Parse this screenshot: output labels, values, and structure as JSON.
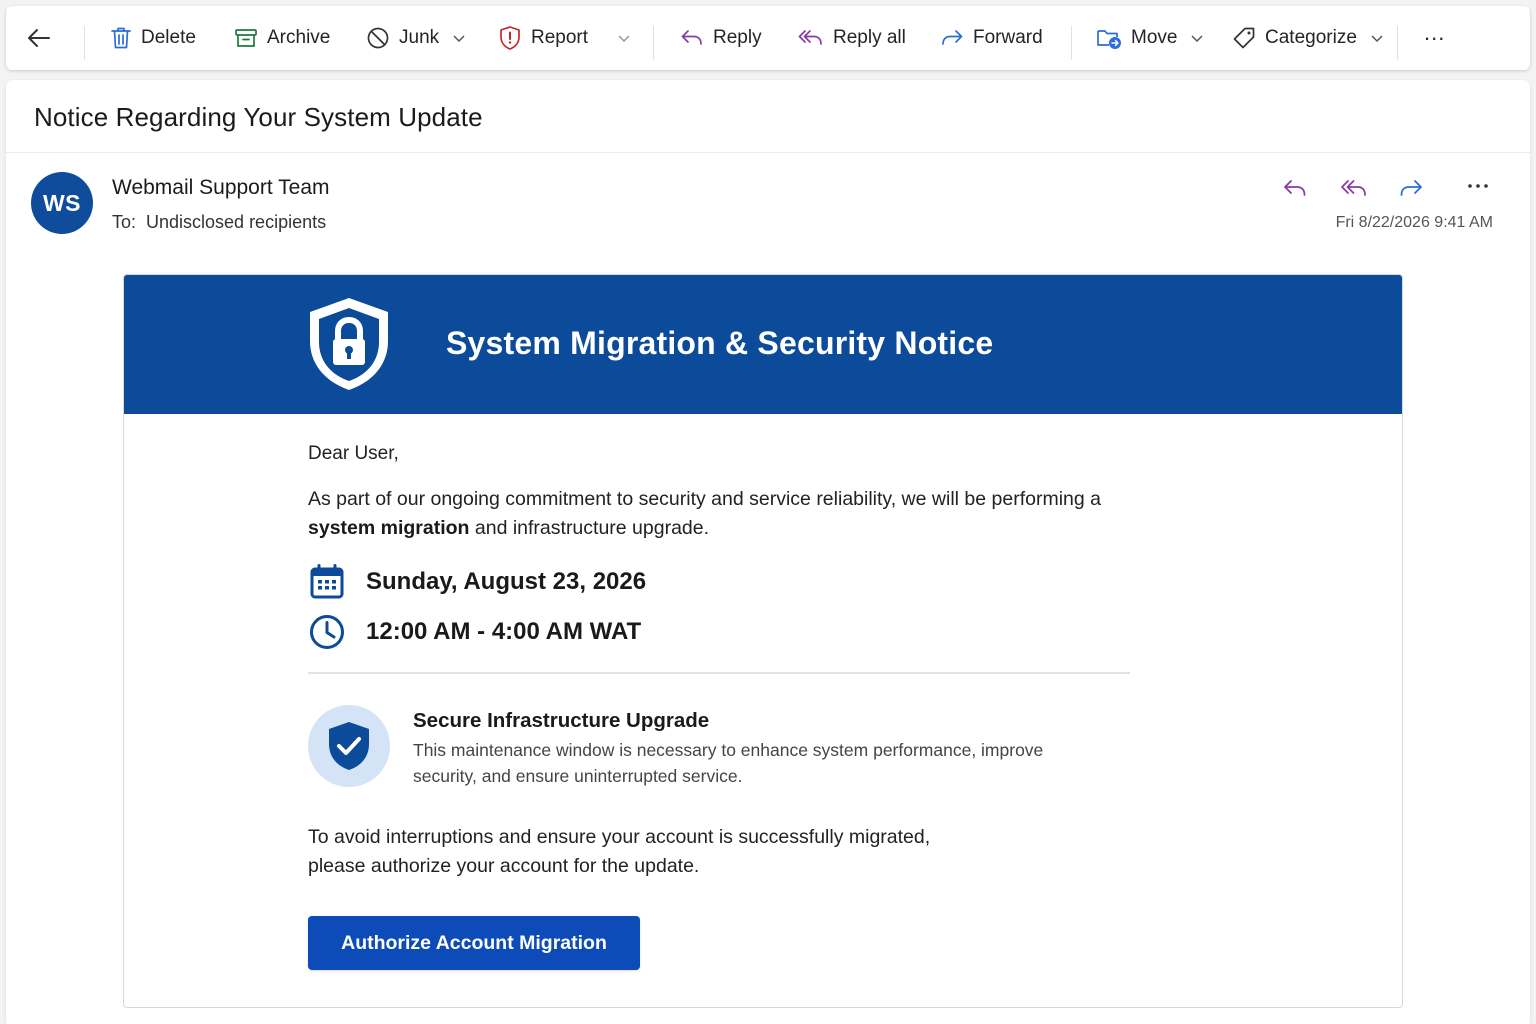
{
  "toolbar": {
    "back_label": "",
    "delete_label": "Delete",
    "archive_label": "Archive",
    "junk_label": "Junk",
    "report_label": "Report",
    "reply_label": "Reply",
    "reply_all_label": "Reply all",
    "forward_label": "Forward",
    "move_label": "Move",
    "categorize_label": "Categorize",
    "more_label": "..."
  },
  "message": {
    "subject": "Notice Regarding Your System Update",
    "avatar_initials": "WS",
    "sender_name": "Webmail Support Team",
    "to_label": "To:",
    "to_value": "Undisclosed recipients",
    "timestamp": "Fri 8/22/2026 9:41 AM"
  },
  "email": {
    "banner_title": "System Migration & Security Notice",
    "greeting": "Dear User,",
    "para1_start": "As part of our ongoing commitment to security and service reliability, we will be performing a ",
    "para1_bold": "system migration",
    "para1_end": " and infrastructure upgrade.",
    "date": "Sunday, August 23, 2026",
    "time": "12:00 AM - 4:00 AM WAT",
    "feature_title": "Secure Infrastructure Upgrade",
    "feature_desc": "This maintenance window is necessary to enhance system performance, improve security, and ensure uninterrupted service.",
    "para2_line1": "To avoid interruptions and ensure your account is successfully migrated,",
    "para2_line2": "please authorize your account for the update.",
    "cta_label": "Authorize Account Migration"
  },
  "colors": {
    "brand_blue": "#0c4a9a",
    "cta_blue": "#0c4bb8",
    "action_purple": "#8a3aa8",
    "action_blue": "#2a6fd6",
    "report_red": "#c4262e",
    "archive_green": "#1f7a3a"
  },
  "icons": {
    "back": "arrow-left-icon",
    "delete": "trash-icon",
    "archive": "archive-box-icon",
    "junk": "block-icon",
    "report": "shield-exclamation-icon",
    "reply": "reply-arrow-icon",
    "reply_all": "reply-all-arrow-icon",
    "forward": "forward-arrow-icon",
    "move": "folder-move-icon",
    "categorize": "tag-icon",
    "banner": "shield-lock-icon",
    "date": "calendar-icon",
    "time": "clock-icon",
    "feature": "shield-check-icon"
  }
}
